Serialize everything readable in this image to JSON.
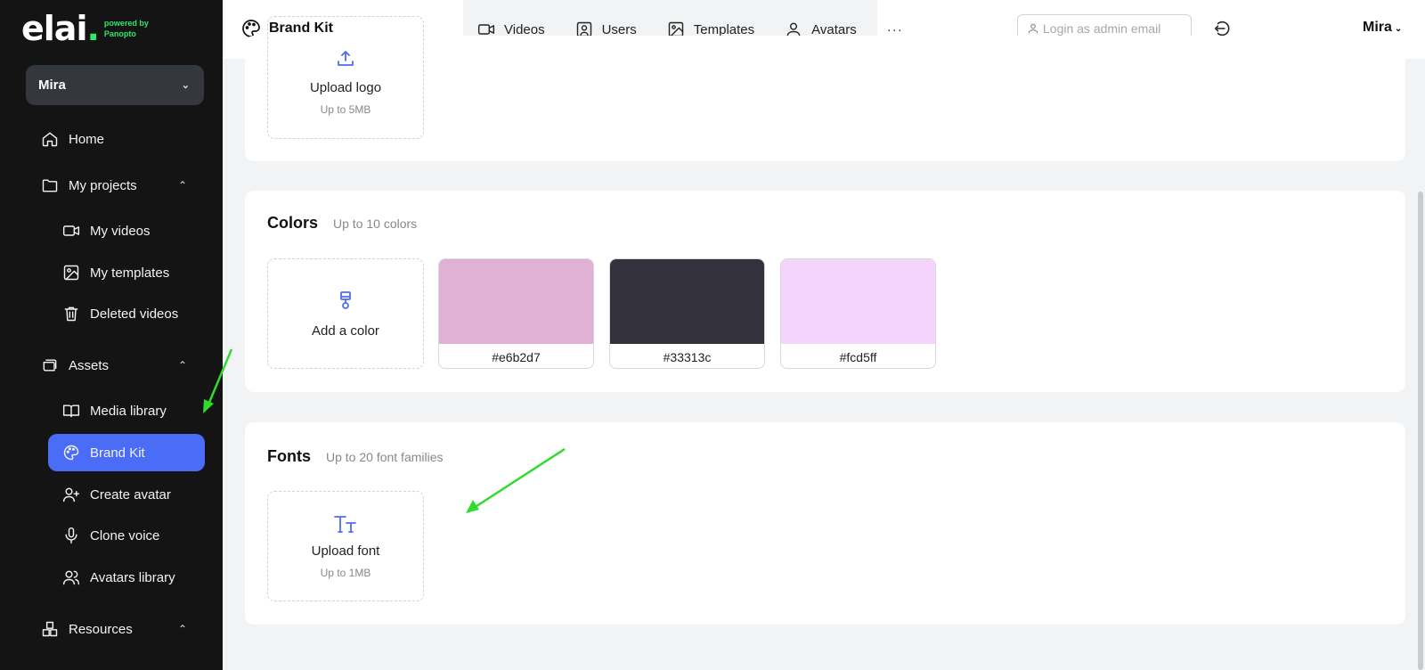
{
  "brand": {
    "logo_text": "elai",
    "logo_dot": ".",
    "powered_by": "powered by",
    "partner": "Panopto"
  },
  "workspace": {
    "name": "Mira"
  },
  "sidebar": {
    "home": "Home",
    "my_projects": "My projects",
    "my_videos": "My videos",
    "my_templates": "My templates",
    "deleted_videos": "Deleted videos",
    "assets": "Assets",
    "media_library": "Media library",
    "brand_kit": "Brand Kit",
    "create_avatar": "Create avatar",
    "clone_voice": "Clone voice",
    "avatars_library": "Avatars library",
    "resources": "Resources"
  },
  "header": {
    "title": "Brand Kit",
    "tabs": [
      "Videos",
      "Users",
      "Templates",
      "Avatars"
    ],
    "more": "···",
    "admin_placeholder": "Login as admin email",
    "user": "Mira"
  },
  "logo_card": {
    "upload_label": "Upload logo",
    "upload_hint": "Up to 5MB"
  },
  "colors_card": {
    "title": "Colors",
    "hint": "Up to 10 colors",
    "add_label": "Add a color",
    "swatches": [
      {
        "hex": "#e6b2d7",
        "display_color": "#e0b1d4"
      },
      {
        "hex": "#33313c",
        "display_color": "#33313c"
      },
      {
        "hex": "#fcd5ff",
        "display_color": "#f5d4fb"
      }
    ]
  },
  "fonts_card": {
    "title": "Fonts",
    "hint": "Up to 20 font families",
    "upload_label": "Upload font",
    "upload_hint": "Up to 1MB"
  },
  "theme": {
    "accent": "#4a6cf7",
    "sidebar_bg": "#141414",
    "brand_green": "#2ee86c",
    "annotation_arrow": "#2ddc2d"
  }
}
